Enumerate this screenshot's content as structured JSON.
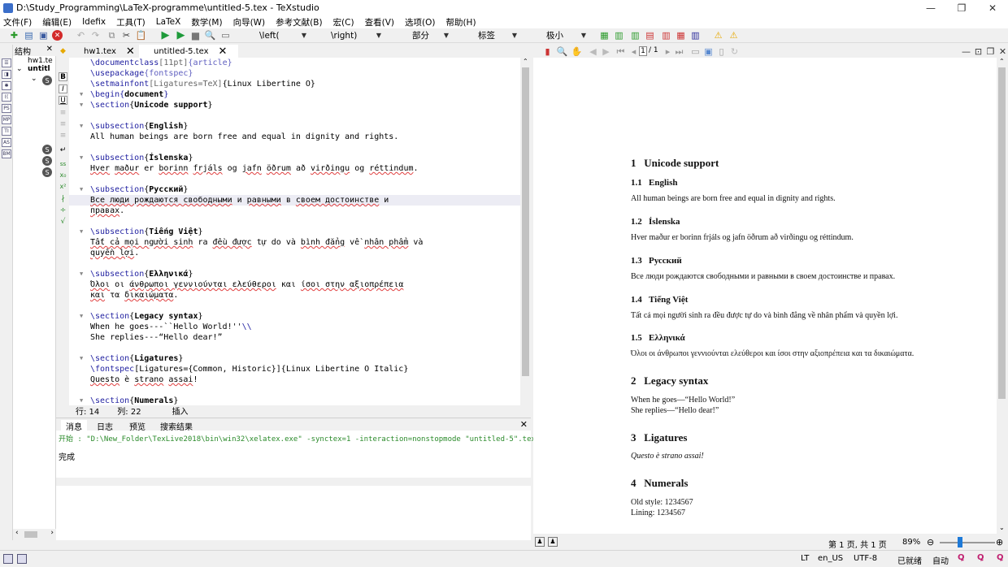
{
  "window": {
    "title": "D:\\Study_Programming\\LaTeX-programme\\untitled-5.tex - TeXstudio"
  },
  "menu": [
    "文件(F)",
    "编辑(E)",
    "Idefix",
    "工具(T)",
    "LaTeX",
    "数学(M)",
    "向导(W)",
    "参考文献(B)",
    "宏(C)",
    "查看(V)",
    "选项(O)",
    "帮助(H)"
  ],
  "toolbar": {
    "combo_left": "\\left(",
    "combo_right": "\\right)",
    "combo_part": "部分",
    "combo_label": "标签",
    "combo_size": "极小"
  },
  "structure": {
    "title": "结构",
    "file1": "hw1.te",
    "file2": "untitl"
  },
  "tabs": [
    {
      "label": "hw1.tex"
    },
    {
      "label": "untitled-5.tex"
    }
  ],
  "editor_lines": [
    {
      "parts": [
        [
          "cmd",
          "\\documentclass"
        ],
        [
          "opt",
          "[11pt]"
        ],
        [
          "pkg",
          "{article}"
        ]
      ]
    },
    {
      "parts": [
        [
          "cmd",
          "\\usepackage"
        ],
        [
          "pkg",
          "{fontspec}"
        ]
      ]
    },
    {
      "parts": [
        [
          "cmd",
          "\\setmainfont"
        ],
        [
          "opt",
          "[Ligatures=TeX]"
        ],
        [
          "kw",
          "{Linux Libertine O}"
        ]
      ]
    },
    {
      "fold": true,
      "parts": [
        [
          "cmd",
          "\\begin"
        ],
        [
          "cmd",
          "{"
        ],
        [
          "arg",
          "document"
        ],
        [
          "cmd",
          "}"
        ]
      ]
    },
    {
      "fold": true,
      "parts": [
        [
          "cmd",
          "\\section"
        ],
        [
          "kw",
          "{"
        ],
        [
          "arg",
          "Unicode support"
        ],
        [
          "kw",
          "}"
        ]
      ]
    },
    {
      "parts": []
    },
    {
      "fold": true,
      "parts": [
        [
          "cmd",
          "\\subsection"
        ],
        [
          "kw",
          "{"
        ],
        [
          "arg",
          "English"
        ],
        [
          "kw",
          "}"
        ]
      ]
    },
    {
      "parts": [
        [
          "kw",
          "All human beings are born free and equal in dignity and rights."
        ]
      ]
    },
    {
      "parts": []
    },
    {
      "fold": true,
      "parts": [
        [
          "cmd",
          "\\subsection"
        ],
        [
          "kw",
          "{"
        ],
        [
          "arg",
          "Íslenska"
        ],
        [
          "kw",
          "}"
        ]
      ]
    },
    {
      "parts": [
        [
          "sp",
          "Hver"
        ],
        [
          "kw",
          " "
        ],
        [
          "sp",
          "maður"
        ],
        [
          "kw",
          " er "
        ],
        [
          "sp",
          "borinn"
        ],
        [
          "kw",
          " "
        ],
        [
          "sp",
          "frjáls"
        ],
        [
          "kw",
          " og "
        ],
        [
          "sp",
          "jafn"
        ],
        [
          "kw",
          " "
        ],
        [
          "sp",
          "öðrum"
        ],
        [
          "kw",
          " að "
        ],
        [
          "sp",
          "virðingu"
        ],
        [
          "kw",
          " og "
        ],
        [
          "sp",
          "réttindum"
        ],
        [
          "kw",
          "."
        ]
      ]
    },
    {
      "parts": []
    },
    {
      "fold": true,
      "parts": [
        [
          "cmd",
          "\\subsection"
        ],
        [
          "kw",
          "{"
        ],
        [
          "arg",
          "Русский"
        ],
        [
          "kw",
          "}"
        ]
      ]
    },
    {
      "hl": true,
      "parts": [
        [
          "sp",
          "Все люди рождаются свободными"
        ],
        [
          "kw",
          " и "
        ],
        [
          "sp",
          "равными"
        ],
        [
          "kw",
          " в "
        ],
        [
          "sp",
          "своем достоинстве"
        ],
        [
          "kw",
          " и"
        ]
      ]
    },
    {
      "parts": [
        [
          "sp",
          "правах"
        ],
        [
          "kw",
          "."
        ]
      ]
    },
    {
      "parts": []
    },
    {
      "fold": true,
      "parts": [
        [
          "cmd",
          "\\subsection"
        ],
        [
          "kw",
          "{"
        ],
        [
          "arg",
          "Tiếng Việt"
        ],
        [
          "kw",
          "}"
        ]
      ]
    },
    {
      "parts": [
        [
          "sp",
          "Tất cả mọi người sinh"
        ],
        [
          "kw",
          " ra "
        ],
        [
          "sp",
          "đều được"
        ],
        [
          "kw",
          " tự do và "
        ],
        [
          "sp",
          "bình đẳng"
        ],
        [
          "kw",
          " về "
        ],
        [
          "sp",
          "nhân phẩm"
        ],
        [
          "kw",
          " và"
        ]
      ]
    },
    {
      "parts": [
        [
          "sp",
          "quyền lợi"
        ],
        [
          "kw",
          "."
        ]
      ]
    },
    {
      "parts": []
    },
    {
      "fold": true,
      "parts": [
        [
          "cmd",
          "\\subsection"
        ],
        [
          "kw",
          "{"
        ],
        [
          "arg",
          "Ελληνικά"
        ],
        [
          "kw",
          "}"
        ]
      ]
    },
    {
      "parts": [
        [
          "sp",
          "Όλοι"
        ],
        [
          "kw",
          " οι "
        ],
        [
          "sp",
          "άνθρωποι γεννιούνται ελεύθεροι"
        ],
        [
          "kw",
          " και "
        ],
        [
          "sp",
          "ίσοι στην αξιοπρέπεια"
        ]
      ]
    },
    {
      "parts": [
        [
          "sp",
          "και"
        ],
        [
          "kw",
          " τα "
        ],
        [
          "sp",
          "δικαιώματα"
        ],
        [
          "kw",
          "."
        ]
      ]
    },
    {
      "parts": []
    },
    {
      "fold": true,
      "parts": [
        [
          "cmd",
          "\\section"
        ],
        [
          "kw",
          "{"
        ],
        [
          "arg",
          "Legacy syntax"
        ],
        [
          "kw",
          "}"
        ]
      ]
    },
    {
      "parts": [
        [
          "kw",
          "When he goes---``Hello World!''"
        ],
        [
          "cmd",
          "\\\\"
        ]
      ]
    },
    {
      "parts": [
        [
          "kw",
          "She replies---“Hello dear!”"
        ]
      ]
    },
    {
      "parts": []
    },
    {
      "fold": true,
      "parts": [
        [
          "cmd",
          "\\section"
        ],
        [
          "kw",
          "{"
        ],
        [
          "arg",
          "Ligatures"
        ],
        [
          "kw",
          "}"
        ]
      ]
    },
    {
      "parts": [
        [
          "cmd",
          "\\fontspec"
        ],
        [
          "kw",
          "[Ligatures={Common, Historic}]{Linux Libertine O Italic}"
        ]
      ]
    },
    {
      "parts": [
        [
          "sp",
          "Questo"
        ],
        [
          "kw",
          " è "
        ],
        [
          "sp",
          "strano"
        ],
        [
          "kw",
          " "
        ],
        [
          "sp",
          "assai"
        ],
        [
          "kw",
          "!"
        ]
      ]
    },
    {
      "parts": []
    },
    {
      "fold": true,
      "parts": [
        [
          "cmd",
          "\\section"
        ],
        [
          "kw",
          "{"
        ],
        [
          "arg",
          "Numerals"
        ],
        [
          "kw",
          "}"
        ]
      ]
    }
  ],
  "status": {
    "row": "行: 14",
    "col": "列: 22",
    "mode": "插入"
  },
  "messages": {
    "tabs": [
      "消息",
      "日志",
      "预览",
      "搜索结果"
    ],
    "line1": "开始 : \"D:\\New_Folder\\TexLive2018\\bin\\win32\\xelatex.exe\" -synctex=1 -interaction=nonstopmode \"untitled-5\".tex",
    "line2": "完成"
  },
  "pdf": {
    "page_info": "/ 1",
    "page_num": "1",
    "footer": "第 1 页, 共 1 页",
    "zoom": "89%",
    "s1": "1",
    "s1t": "Unicode support",
    "ss1": "1.1",
    "ss1t": "English",
    "p1": "All human beings are born free and equal in dignity and rights.",
    "ss2": "1.2",
    "ss2t": "Íslenska",
    "p2": "Hver maður er borinn frjáls og jafn öðrum að virðingu og réttindum.",
    "ss3": "1.3",
    "ss3t": "Русский",
    "p3": "Все люди рождаются свободными и равными в своем достоинстве и правах.",
    "ss4": "1.4",
    "ss4t": "Tiếng Việt",
    "p4": "Tất cả mọi người sinh ra đều được tự do và bình đẳng về nhân phẩm và quyền lợi.",
    "ss5": "1.5",
    "ss5t": "Ελληνικά",
    "p5": "Όλοι οι άνθρωποι γεννιούνται ελεύθεροι και ίσοι στην αξιοπρέπεια και τα δικαιώματα.",
    "s2": "2",
    "s2t": "Legacy syntax",
    "p6": "When he goes—“Hello World!”",
    "p7": "She replies—“Hello dear!”",
    "s3": "3",
    "s3t": "Ligatures",
    "p8": "Questo è strano assai!",
    "s4": "4",
    "s4t": "Numerals",
    "p9": "Old style: 1234567",
    "p10": "Lining: 1234567"
  },
  "bottom": {
    "lt": "LT",
    "lang": "en_US",
    "enc": "UTF-8",
    "ready": "已就绪",
    "auto": "自动"
  }
}
